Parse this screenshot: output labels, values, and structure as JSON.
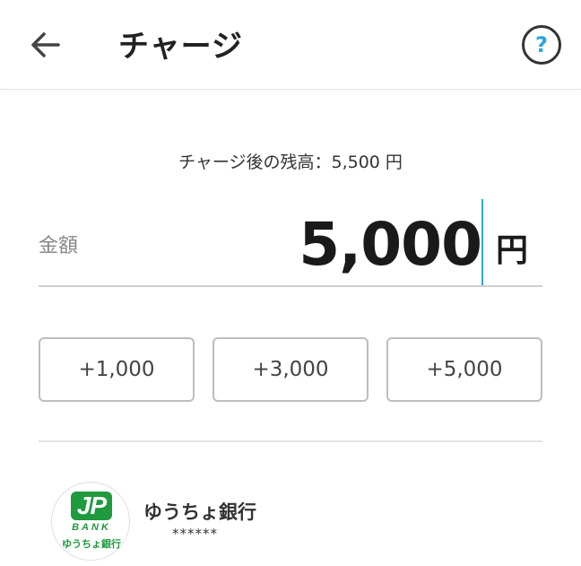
{
  "header": {
    "title": "チャージ",
    "back_icon": "arrow-left-icon",
    "help_icon": "question-circle-icon",
    "help_symbol": "?"
  },
  "balance_after": "チャージ後の残高：5,500 円",
  "amount": {
    "label": "金額",
    "value": "5,000",
    "unit": "円"
  },
  "quick_add": [
    {
      "label": "+1,000"
    },
    {
      "label": "+3,000"
    },
    {
      "label": "+5,000"
    }
  ],
  "bank": {
    "logo_mark": "JP",
    "logo_sub": "BANK",
    "logo_name": "ゆうちょ銀行",
    "name": "ゆうちょ銀行",
    "account_masked": "******"
  },
  "colors": {
    "accent": "#2aa6e0",
    "bank_green": "#1f9a3e"
  }
}
